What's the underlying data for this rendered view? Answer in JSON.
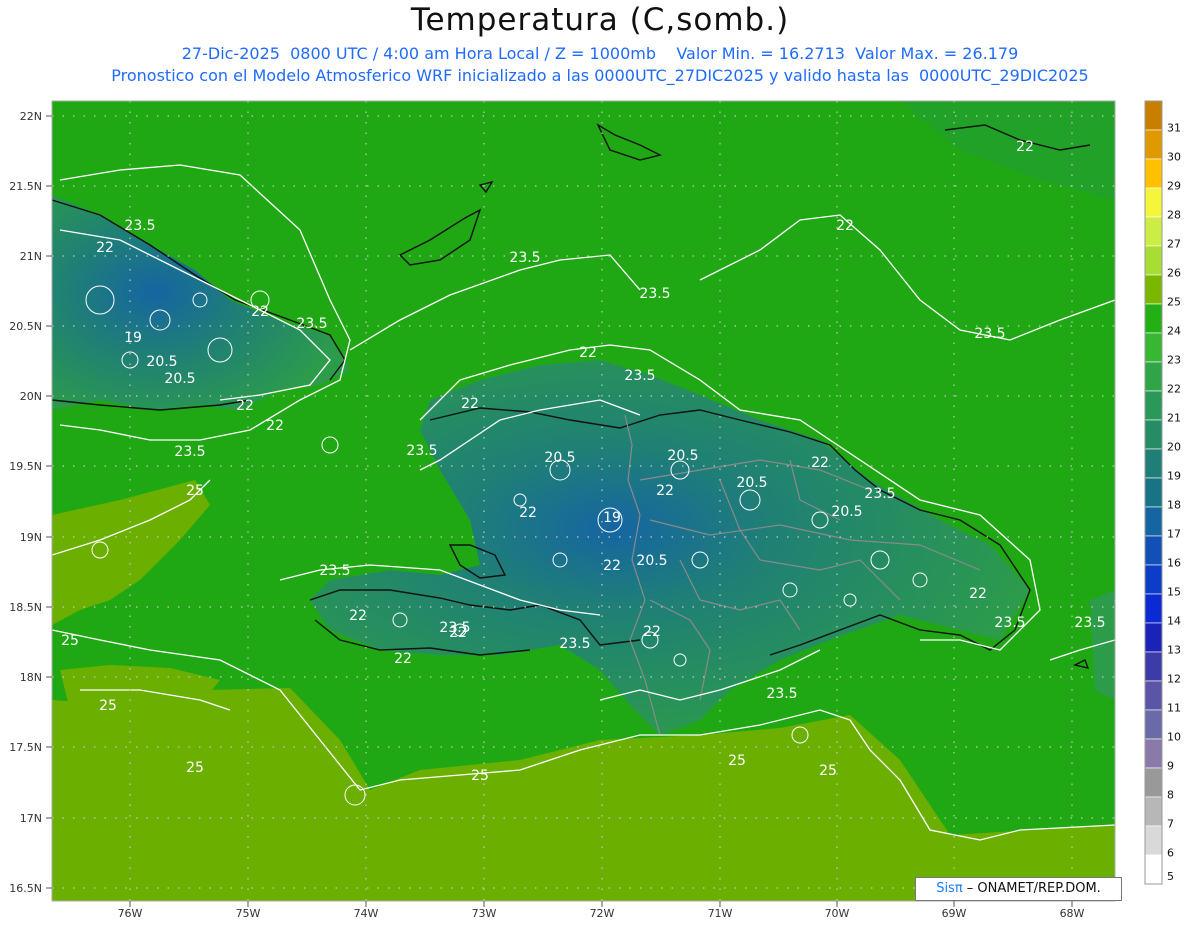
{
  "header": {
    "title": "Temperatura (C,somb.)",
    "subtitle1": "27-Dic-2025  0800 UTC / 4:00 am Hora Local / Z = 1000mb    Valor Min. = 16.2713  Valor Max. = 26.179",
    "subtitle2": "Pronostico con el Modelo Atmosferico WRF inicializado a las 0000UTC_27DIC2025 y valido hasta las  0000UTC_29DIC2025"
  },
  "axes": {
    "lat_labels": [
      "22N",
      "21.5N",
      "21N",
      "20.5N",
      "20N",
      "19.5N",
      "19N",
      "18.5N",
      "18N",
      "17.5N",
      "17N",
      "16.5N"
    ],
    "lon_labels": [
      "76W",
      "75W",
      "74W",
      "73W",
      "72W",
      "71W",
      "70W",
      "69W",
      "68W"
    ]
  },
  "colorbar": {
    "values": [
      "31",
      "30",
      "29",
      "28",
      "27",
      "26",
      "25",
      "24",
      "23",
      "22",
      "21",
      "20",
      "19",
      "18",
      "17",
      "16",
      "15",
      "14",
      "13",
      "12",
      "11",
      "10",
      "9",
      "8",
      "7",
      "6",
      "5"
    ],
    "colors": [
      "#c87f00",
      "#e09a00",
      "#ffc000",
      "#f5f53a",
      "#ccee44",
      "#a8dd33",
      "#7ab800",
      "#22b014",
      "#38b832",
      "#30a548",
      "#2a9858",
      "#268c66",
      "#1f7f76",
      "#197386",
      "#1565a2",
      "#1150b6",
      "#0d3dc8",
      "#0a2ad4",
      "#1a22b8",
      "#3c3ca8",
      "#5a55a6",
      "#6a6aa8",
      "#8a7aaa",
      "#999999",
      "#b7b7b7",
      "#d9d9d9",
      "#ffffff"
    ]
  },
  "contours": {
    "labels": [
      "23.5",
      "22",
      "23.5",
      "22",
      "19",
      "20.5",
      "20.5",
      "22",
      "22",
      "23.5",
      "23.5",
      "22",
      "23.5",
      "23.5",
      "25",
      "22",
      "20.5",
      "20.5",
      "20.5",
      "22",
      "22",
      "19",
      "20.5",
      "22",
      "20.5",
      "23.5",
      "22",
      "23.5",
      "22",
      "22",
      "23.5",
      "22",
      "22",
      "22",
      "23.5",
      "25",
      "25",
      "23.5",
      "25",
      "25",
      "25",
      "25",
      "23.5",
      "22",
      "23.5",
      "23.5",
      "23.5",
      "22"
    ]
  },
  "credit": {
    "sis": "Sisπ",
    "rest": " – ONAMET/REP.DOM."
  },
  "colors": {
    "sea": "#20a814",
    "shallow": "#6bb000",
    "land": "#2c9c4a",
    "land_cool": "#1f7f76",
    "contour": "#ffffff",
    "coast": "#111111",
    "border": "#8a8a8a"
  }
}
